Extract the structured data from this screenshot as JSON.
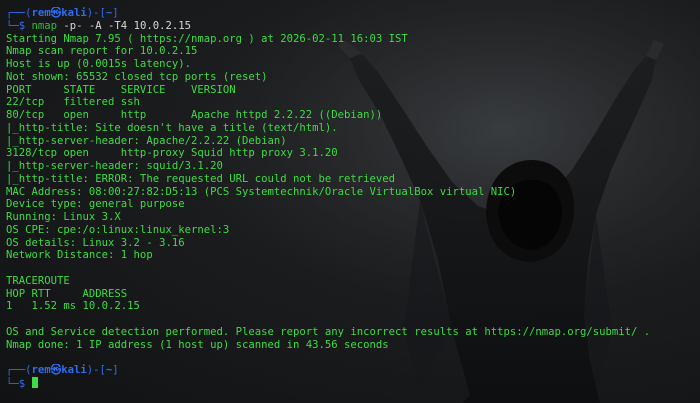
{
  "prompt": {
    "frame_top_open": "┌──(",
    "user": "rem㉿kali",
    "frame_top_mid": ")-[",
    "cwd": "~",
    "frame_top_close": "]",
    "frame_bottom": "└─$ "
  },
  "command": {
    "name": "nmap",
    "args": " -p- -A -T4 10.0.2.15"
  },
  "output": {
    "start": "Starting Nmap 7.95 ( https://nmap.org ) at 2026-02-11 16:03 IST",
    "report": "Nmap scan report for 10.0.2.15",
    "host_up": "Host is up (0.0015s latency).",
    "not_shown": "Not shown: 65532 closed tcp ports (reset)",
    "table_header": "PORT     STATE    SERVICE    VERSION",
    "port22": "22/tcp   filtered ssh",
    "port80": "80/tcp   open     http       Apache httpd 2.2.22 ((Debian))",
    "p80_title": "|_http-title: Site doesn't have a title (text/html).",
    "p80_header": "|_http-server-header: Apache/2.2.22 (Debian)",
    "port3128": "3128/tcp open     http-proxy Squid http proxy 3.1.20",
    "p3128_header": "|_http-server-header: squid/3.1.20",
    "p3128_title": "|_http-title: ERROR: The requested URL could not be retrieved",
    "mac": "MAC Address: 08:00:27:82:D5:13 (PCS Systemtechnik/Oracle VirtualBox virtual NIC)",
    "device": "Device type: general purpose",
    "running": "Running: Linux 3.X",
    "os_cpe": "OS CPE: cpe:/o:linux:linux_kernel:3",
    "os_details": "OS details: Linux 3.2 - 3.16",
    "distance": "Network Distance: 1 hop",
    "traceroute": "TRACEROUTE",
    "trace_header": "HOP RTT     ADDRESS",
    "trace_row": "1   1.52 ms 10.0.2.15",
    "detection": "OS and Service detection performed. Please report any incorrect results at https://nmap.org/submit/ .",
    "done": "Nmap done: 1 IP address (1 host up) scanned in 43.56 seconds"
  },
  "colors": {
    "output_green": "#3ddc45",
    "prompt_blue": "#2f6df0",
    "command_green": "#2fbf3a",
    "args_white": "#d8d8d8",
    "background": "#151617"
  }
}
